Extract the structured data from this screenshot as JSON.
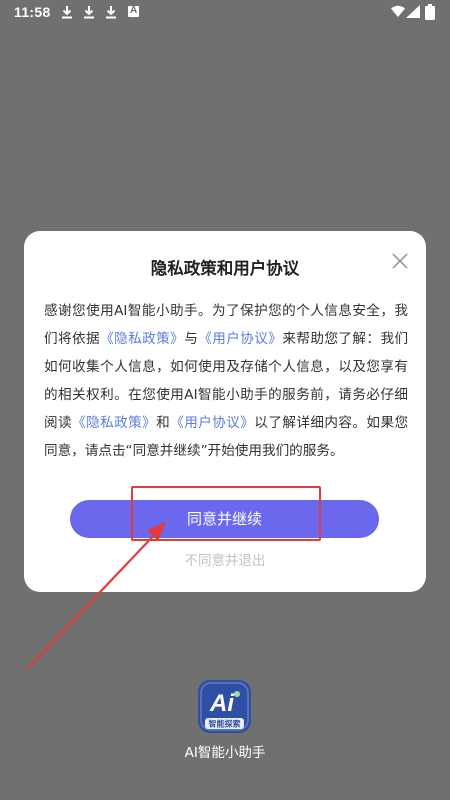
{
  "status_bar": {
    "time": "11:58",
    "icons": [
      "download-icon",
      "download-icon",
      "download-icon",
      "a-notification-icon",
      "wifi-icon",
      "signal-icon",
      "battery-icon"
    ],
    "a_letter": "A"
  },
  "dialog": {
    "title": "隐私政策和用户协议",
    "body": {
      "s1": "感谢您使用AI智能小助手。为了保护您的个人信息安全，我们将依据",
      "link_privacy": "《隐私政策》",
      "s2": "与",
      "link_agreement": "《用户协议》",
      "s3": "来帮助您了解：我们如何收集个人信息，如何使用及存储个人信息，以及您享有的相关权利。在您使用AI智能小助手的服务前，请务必仔细阅读",
      "link_privacy2": "《隐私政策》",
      "s4": "和",
      "link_agreement2": "《用户协议》",
      "s5": "以了解详细内容。如果您同意，请点击“同意并继续”开始使用我们的服务。"
    },
    "agree_label": "同意并继续",
    "reject_label": "不同意并退出"
  },
  "splash": {
    "logo_text": "Ai",
    "logo_caption": "智能探索",
    "app_name": "AI智能小助手"
  },
  "colors": {
    "accent": "#6c68ee",
    "link": "#5b7de0",
    "annotation": "#e23b3b",
    "overlay_bg": "#707070",
    "logo_bg": "#2f4fa5"
  }
}
